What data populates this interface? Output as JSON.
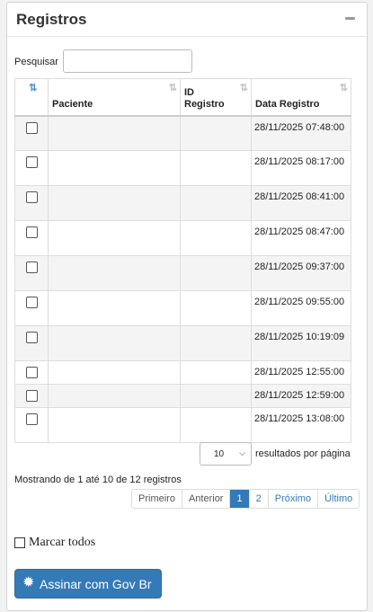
{
  "panel": {
    "title": "Registros"
  },
  "search": {
    "label": "Pesquisar",
    "value": "",
    "placeholder": ""
  },
  "table": {
    "columns": [
      "",
      "Paciente",
      "ID\nRegistro",
      "Data Registro"
    ],
    "sort_icons": {
      "active": "⇅",
      "inactive": "⇅"
    },
    "rows": [
      {
        "paciente": "",
        "id": "",
        "date": "28/11/2025 07:48:00"
      },
      {
        "paciente": "",
        "id": "",
        "date": "28/11/2025 08:17:00"
      },
      {
        "paciente": "",
        "id": "",
        "date": "28/11/2025 08:41:00"
      },
      {
        "paciente": "",
        "id": "",
        "date": "28/11/2025 08:47:00"
      },
      {
        "paciente": "",
        "id": "",
        "date": "28/11/2025 09:37:00"
      },
      {
        "paciente": "",
        "id": "",
        "date": "28/11/2025 09:55:00"
      },
      {
        "paciente": "",
        "id": "",
        "date": "28/11/2025 10:19:09"
      },
      {
        "paciente": "",
        "id": "",
        "date": "28/11/2025 12:55:00"
      },
      {
        "paciente": "",
        "id": "",
        "date": "28/11/2025 12:59:00"
      },
      {
        "paciente": "",
        "id": "",
        "date": "28/11/2025 13:08:00"
      }
    ]
  },
  "length": {
    "selected": "10",
    "label": "resultados por página"
  },
  "info": "Mostrando de 1 até 10 de 12 registros",
  "pagination": {
    "first": "Primeiro",
    "previous": "Anterior",
    "pages": [
      "1",
      "2"
    ],
    "next": "Próximo",
    "last": "Último"
  },
  "mark_all_label": "Marcar todos",
  "sign_button": {
    "label": "Assinar com Gov Br",
    "icon": "gear-icon"
  },
  "colors": {
    "primary": "#337ab7",
    "sort_active": "#4a90d9"
  }
}
